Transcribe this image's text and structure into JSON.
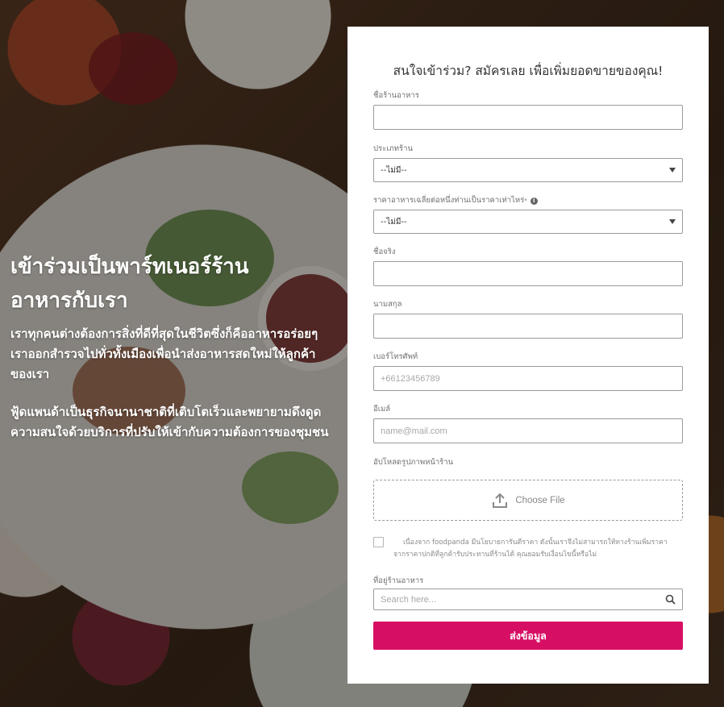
{
  "hero": {
    "title": "เข้าร่วมเป็นพาร์ทเนอร์ร้านอาหารกับเรา",
    "paragraph1": "เราทุกคนต่างต้องการสิ่งที่ดีที่สุดในชีวิตซึ่งก็คืออาหารอร่อยๆ  เราออกสำรวจไปทั่วทั้งเมืองเพื่อนำส่งอาหารสดใหม่ให้ลูกค้าของเรา",
    "paragraph2": "ฟู้ดแพนด้าเป็นธุรกิจนานาชาติที่เติบโตเร็วและพยายามดึงดูดความสนใจด้วยบริการที่ปรับให้เข้ากับความต้องการของชุมชน"
  },
  "form": {
    "title": "สนใจเข้าร่วม? สมัครเลย เพื่อเพิ่มยอดขายของคุณ!",
    "restaurant_name_label": "ชื่อร้านอาหาร",
    "restaurant_name_value": "",
    "restaurant_type_label": "ประเภทร้าน",
    "restaurant_type_selected": "--ไม่มี--",
    "avg_price_label": "ราคาอาหารเฉลี่ยต่อหนึ่งท่านเป็นราคาเท่าไหร่",
    "avg_price_required_mark": "*",
    "avg_price_selected": "--ไม่มี--",
    "first_name_label": "ชื่อจริง",
    "first_name_value": "",
    "last_name_label": "นามสกุล",
    "last_name_value": "",
    "phone_label": "เบอร์โทรศัพท์",
    "phone_placeholder": "+66123456789",
    "email_label": "อีเมล์",
    "email_placeholder": "name@mail.com",
    "upload_label": "อัปโหลดรูปภาพหน้าร้าน",
    "upload_button": "Choose File",
    "consent_line1": "เนื่องจาก foodpanda มีนโยบายการันตีราคา ดังนั้นเราจึงไม่สามารถให้ทางร้านเพิ่มราคา",
    "consent_line2": "จากราคาปกติที่ลูกค้ารับประทานที่ร้านได้ คุณยอมรับเงื่อนไขนี้หรือไม่",
    "address_label": "ที่อยู่ร้านอาหาร",
    "address_placeholder": "Search here...",
    "submit_label": "ส่งข้อมูล"
  },
  "colors": {
    "accent": "#d70f64",
    "overlay": "rgba(0,0,0,0.38)"
  },
  "icons": [
    "info-icon",
    "dropdown-caret-icon",
    "upload-icon",
    "search-icon"
  ]
}
